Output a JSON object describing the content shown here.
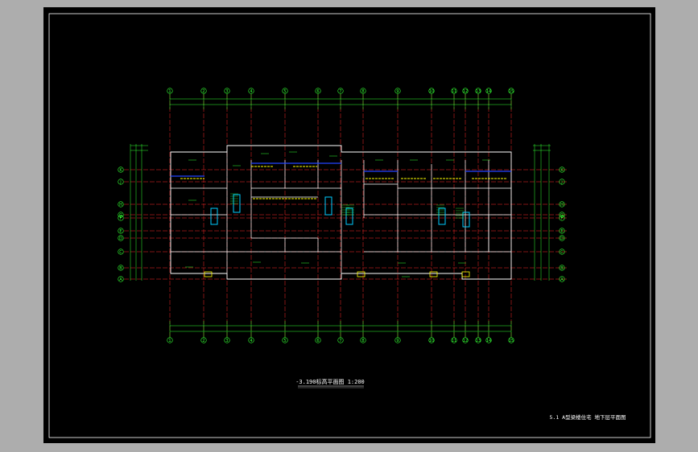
{
  "drawing": {
    "plan_title": "-3.190标高平面图 1:200",
    "sheet_title": "5.1 A型梁楼住宅 地下层平面图",
    "column_axes": [
      "1",
      "2",
      "3",
      "4",
      "5",
      "6",
      "7",
      "8",
      "9",
      "10",
      "11",
      "12",
      "13",
      "14",
      "15"
    ],
    "row_axes": [
      "A",
      "B",
      "C",
      "D",
      "E",
      "F",
      "G",
      "H",
      "J",
      "K"
    ],
    "colors": {
      "background": "#000000",
      "frame": "#ffffff",
      "dimension": "#33ff33",
      "axis_line": "#ff2a2a",
      "wall": "#ffffff",
      "stair": "#00ccff",
      "door": "#ffff00",
      "window": "#2244ff"
    }
  }
}
